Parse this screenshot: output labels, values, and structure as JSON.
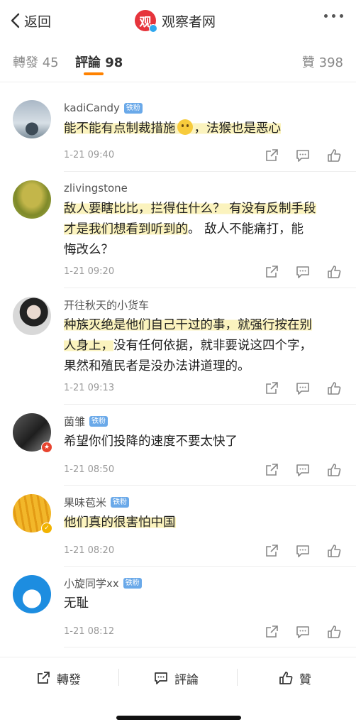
{
  "nav": {
    "back_label": "返回",
    "logo_char": "观",
    "title": "观察者网"
  },
  "tabs": {
    "repost_label": "轉發",
    "repost_count": "45",
    "comments_label": "評論",
    "comments_count": "98",
    "likes_label": "贊",
    "likes_count": "398",
    "accent_color": "#ff8200"
  },
  "comments": [
    {
      "username": "kadiCandy",
      "badge": "铁粉",
      "text_parts": [
        "能不能有点制裁措施",
        "，法猴也是恶心"
      ],
      "has_emoji": true,
      "time": "1-21 09:40"
    },
    {
      "username": "zlivingstone",
      "badge": "",
      "text_highlighted_1": "敌人要瞎比比，拦得住什么？ 有没有反制手段",
      "text_highlighted_2": "才是我们想看到听到的",
      "text_rest_1": "。 敌人不能痛打，能",
      "text_rest_2": "悔改么？",
      "time": "1-21 09:20"
    },
    {
      "username": "开往秋天的小货车",
      "badge": "",
      "text_highlighted_1": "种族灭绝是他们自己干过的事，就强行按在别",
      "text_highlighted_2": "人身上，",
      "text_rest_1": "没有任何依据，就非要说这四个字，",
      "text_rest_2": "果然和殖民者是没办法讲道理的。",
      "time": "1-21 09:13"
    },
    {
      "username": "菌雏",
      "badge": "铁粉",
      "text": "希望你们投降的速度不要太快了",
      "time": "1-21 08:50"
    },
    {
      "username": "果味苞米",
      "badge": "铁粉",
      "text": "他们真的很害怕中国",
      "time": "1-21 08:20"
    },
    {
      "username": "小旋同学xx",
      "badge": "铁粉",
      "text": "无耻",
      "time": "1-21 08:12"
    }
  ],
  "bottom": {
    "repost_label": "轉發",
    "comment_label": "評論",
    "like_label": "贊"
  },
  "icons": {
    "back": "chevron-left-icon",
    "more": "more-dots-icon",
    "repost": "repost-icon",
    "comment": "comment-icon",
    "like": "thumbs-up-icon"
  }
}
